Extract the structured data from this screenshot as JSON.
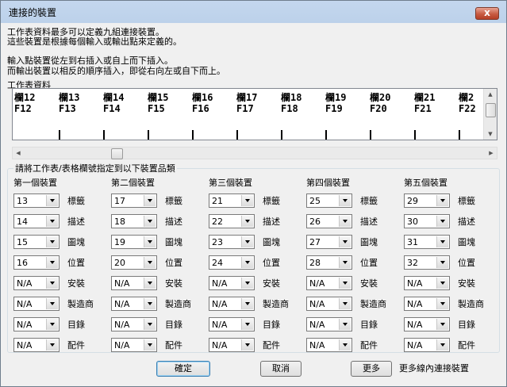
{
  "window": {
    "title": "連接的裝置",
    "close_glyph": "x"
  },
  "description": [
    "工作表資料最多可以定義九組連接裝置。",
    "這些裝置是根據每個輸入或輸出點來定義的。",
    "",
    "輸入點裝置從左到右插入或自上而下插入。",
    "而輸出裝置以相反的順序插入，即從右向左或自下而上。"
  ],
  "sheet": {
    "label": "工作表資料",
    "columns": [
      {
        "field": "欄12",
        "cell": "F12"
      },
      {
        "field": "欄13",
        "cell": "F13"
      },
      {
        "field": "欄14",
        "cell": "F14"
      },
      {
        "field": "欄15",
        "cell": "F15"
      },
      {
        "field": "欄16",
        "cell": "F16"
      },
      {
        "field": "欄17",
        "cell": "F17"
      },
      {
        "field": "欄18",
        "cell": "F18"
      },
      {
        "field": "欄19",
        "cell": "F19"
      },
      {
        "field": "欄20",
        "cell": "F20"
      },
      {
        "field": "欄21",
        "cell": "F21"
      },
      {
        "field": "欄2",
        "cell": "F22"
      }
    ]
  },
  "assign_group": {
    "title": "請將工作表/表格欄號指定到以下裝置品類"
  },
  "property_labels": [
    "標籤",
    "描述",
    "圖塊",
    "位置",
    "安裝",
    "製造商",
    "目錄",
    "配件"
  ],
  "devices": [
    {
      "name": "第一個裝置",
      "values": [
        "13",
        "14",
        "15",
        "16",
        "N/A",
        "N/A",
        "N/A",
        "N/A"
      ]
    },
    {
      "name": "第二個裝置",
      "values": [
        "17",
        "18",
        "19",
        "20",
        "N/A",
        "N/A",
        "N/A",
        "N/A"
      ]
    },
    {
      "name": "第三個裝置",
      "values": [
        "21",
        "22",
        "23",
        "24",
        "N/A",
        "N/A",
        "N/A",
        "N/A"
      ]
    },
    {
      "name": "第四個裝置",
      "values": [
        "25",
        "26",
        "27",
        "28",
        "N/A",
        "N/A",
        "N/A",
        "N/A"
      ]
    },
    {
      "name": "第五個裝置",
      "values": [
        "29",
        "30",
        "31",
        "32",
        "N/A",
        "N/A",
        "N/A",
        "N/A"
      ]
    }
  ],
  "buttons": {
    "ok": "確定",
    "cancel": "取消",
    "more": "更多",
    "more_text": "更多線內連接裝置"
  }
}
